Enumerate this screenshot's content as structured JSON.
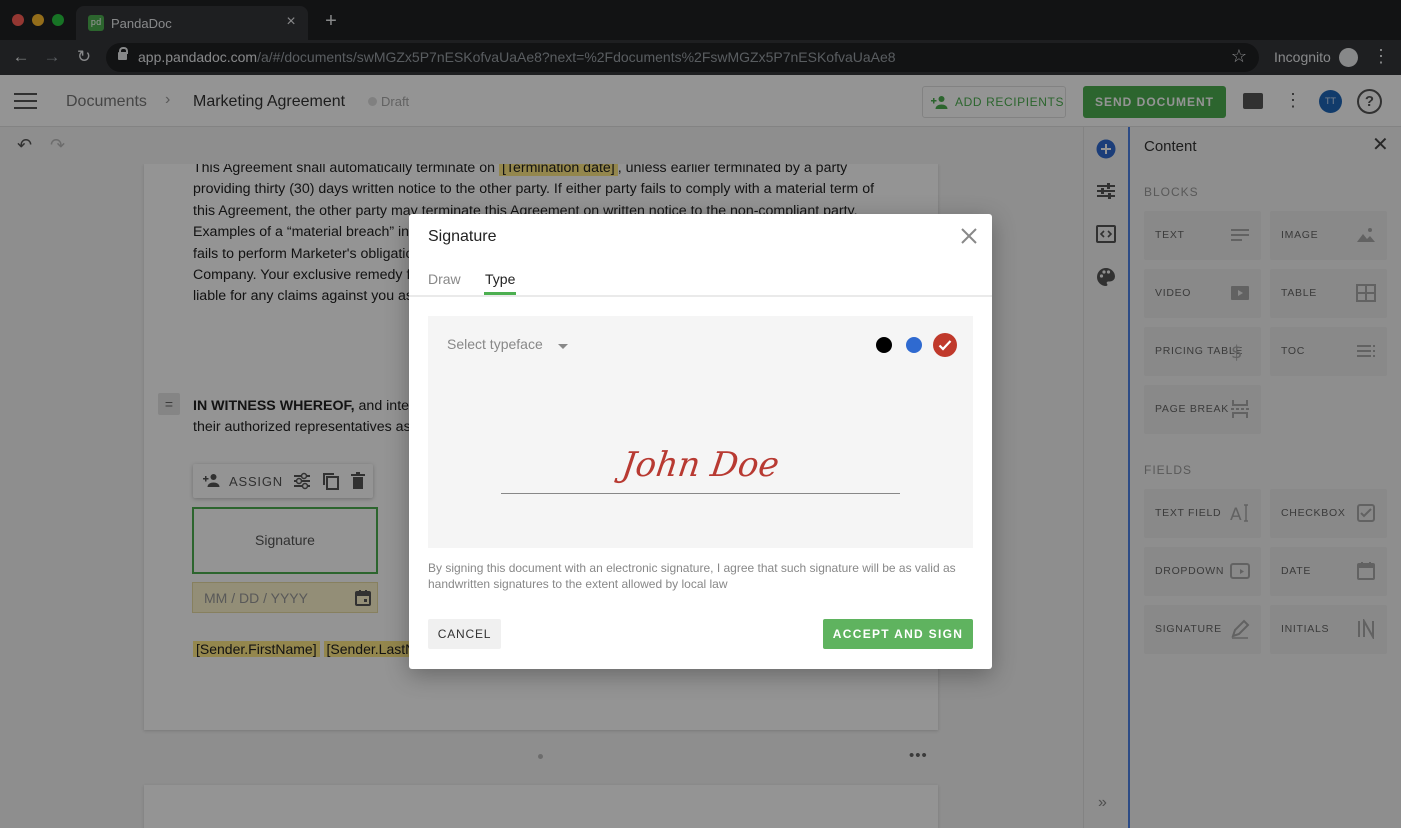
{
  "browser": {
    "tab_title": "PandaDoc",
    "tab_favicon": "pd",
    "url_host": "app.pandadoc.com",
    "url_path": "/a/#/documents/swMGZx5P7nESKofvaUaAe8?next=%2Fdocuments%2FswMGZx5P7nESKofvaUaAe8",
    "incognito_label": "Incognito"
  },
  "header": {
    "breadcrumb_root": "Documents",
    "breadcrumb_current": "Marketing Agreement",
    "status": "Draft",
    "add_recipients": "ADD RECIPIENTS",
    "send_document": "SEND DOCUMENT",
    "avatar_initials": "TT",
    "help": "?"
  },
  "document": {
    "termination_pre": "This Agreement shall automatically terminate on ",
    "termination_token": "[Termination date]",
    "termination_post": ", unless earlier terminated by a party providing thirty (30) days written notice to the other party. If either party fails to comply with a material term of this Agreement, the other party may terminate this Agreement on written notice to the non-compliant party. Examples of a “material breach” include if Marketer fails to comply with the terms of a Transaction, Marketer fails to perform Marketer's obligations under a statement of work, or if Marketer makes misrepresentations to Company. Your exclusive remedy for termination is to provide the notice described above. Company is not liable for any claims against you as a result of such termination or failure to provide additional notice.",
    "witness_bold": "IN WITNESS WHEREOF,",
    "witness_rest": " and intending to be legally bound, the parties have executed this Agreement through their authorized representatives as of the Effective Date.",
    "assign_label": "ASSIGN",
    "signature_field": "Signature",
    "date_placeholder": "MM / DD / YYYY",
    "sender_first": "[Sender.FirstName]",
    "sender_last": "[Sender.LastName]",
    "page_more": "•••"
  },
  "panel": {
    "title": "Content",
    "blocks_heading": "BLOCKS",
    "fields_heading": "FIELDS",
    "blocks": [
      {
        "label": "TEXT",
        "icon": "text-lines-icon"
      },
      {
        "label": "IMAGE",
        "icon": "image-icon"
      },
      {
        "label": "VIDEO",
        "icon": "video-icon"
      },
      {
        "label": "TABLE",
        "icon": "table-icon"
      },
      {
        "label": "PRICING TABLE",
        "icon": "dollar-icon"
      },
      {
        "label": "TOC",
        "icon": "toc-icon"
      },
      {
        "label": "PAGE BREAK",
        "icon": "page-break-icon"
      }
    ],
    "fields": [
      {
        "label": "TEXT FIELD",
        "icon": "text-field-icon"
      },
      {
        "label": "CHECKBOX",
        "icon": "checkbox-icon"
      },
      {
        "label": "DROPDOWN",
        "icon": "dropdown-icon"
      },
      {
        "label": "DATE",
        "icon": "calendar-icon"
      },
      {
        "label": "SIGNATURE",
        "icon": "pen-icon"
      },
      {
        "label": "INITIALS",
        "icon": "initials-icon"
      }
    ]
  },
  "modal": {
    "title": "Signature",
    "tabs": [
      "Draw",
      "Type"
    ],
    "active_tab": "Type",
    "typeface_placeholder": "Select typeface",
    "colors": [
      "#000000",
      "#2f6ad0",
      "#c0392b"
    ],
    "selected_color": "#c0392b",
    "signature_text": "John Doe",
    "legal": "By signing this document with an electronic signature, I agree that such signature will be as valid as handwritten signatures to the extent allowed by local law",
    "cancel": "CANCEL",
    "accept": "ACCEPT AND SIGN"
  },
  "colors": {
    "accent": "#4caf50",
    "signature_ink": "#b83a32"
  }
}
